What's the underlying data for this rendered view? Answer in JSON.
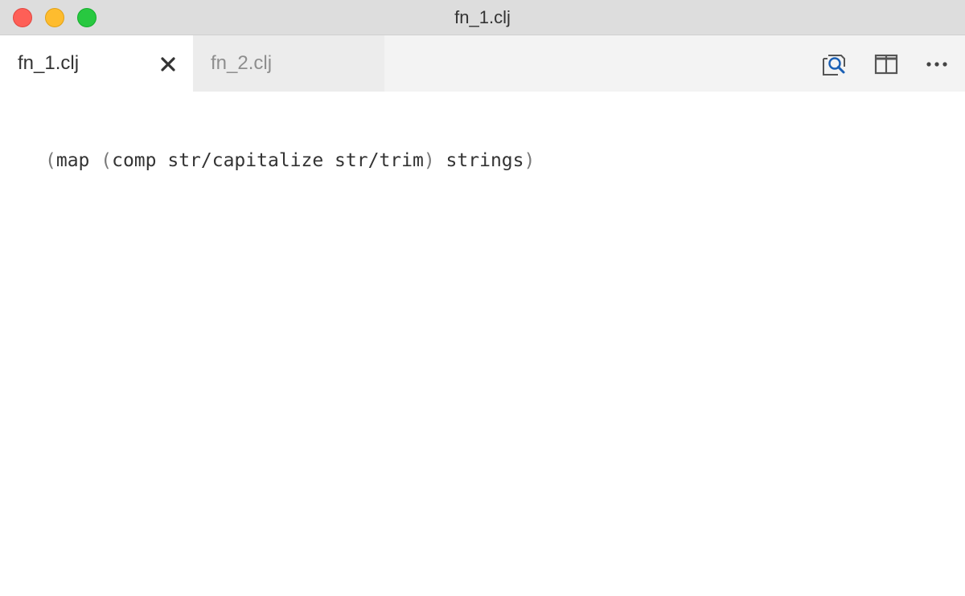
{
  "window": {
    "title": "fn_1.clj"
  },
  "tabs": [
    {
      "label": "fn_1.clj",
      "active": true
    },
    {
      "label": "fn_2.clj",
      "active": false
    }
  ],
  "toolbar": {
    "icons": [
      "find-in-file-icon",
      "split-editor-icon",
      "more-actions-icon"
    ]
  },
  "editor": {
    "code": [
      {
        "kind": "paren",
        "text": "("
      },
      {
        "kind": "text",
        "text": "map "
      },
      {
        "kind": "paren",
        "text": "("
      },
      {
        "kind": "text",
        "text": "comp str/capitalize str/trim"
      },
      {
        "kind": "paren",
        "text": ")"
      },
      {
        "kind": "text",
        "text": " strings"
      },
      {
        "kind": "paren",
        "text": ")"
      }
    ]
  },
  "colors": {
    "titlebar": "#dddddd",
    "tabbar": "#f3f3f3",
    "active_tab": "#ffffff",
    "inactive_tab": "#ececec",
    "icon_accent": "#1a5fb4",
    "close_dot": "#fe5f57",
    "minimize_dot": "#febc2e",
    "zoom_dot": "#28c840"
  }
}
